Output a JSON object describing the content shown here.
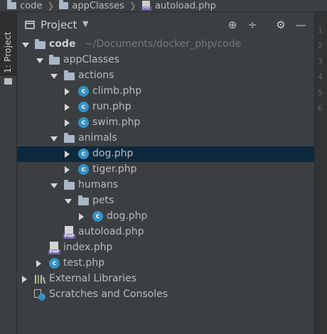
{
  "breadcrumb": {
    "items": [
      {
        "label": "code",
        "icon": "folder-icon"
      },
      {
        "label": "appClasses",
        "icon": "folder-icon"
      },
      {
        "label": "autoload.php",
        "icon": "php-file-icon"
      }
    ]
  },
  "side_tab": {
    "label": "1: Project"
  },
  "panel": {
    "title": "Project",
    "buttons": [
      "locate-icon",
      "collapse-all-icon",
      "gear-icon",
      "hide-icon"
    ]
  },
  "tree": {
    "root": {
      "name": "code",
      "path": "~/Documents/docker_php/code"
    },
    "items": [
      {
        "id": "appClasses",
        "label": "appClasses"
      },
      {
        "id": "actions",
        "label": "actions"
      },
      {
        "id": "climb",
        "label": "climb.php"
      },
      {
        "id": "run",
        "label": "run.php"
      },
      {
        "id": "swim",
        "label": "swim.php"
      },
      {
        "id": "animals",
        "label": "animals"
      },
      {
        "id": "dog",
        "label": "dog.php",
        "selected": true
      },
      {
        "id": "tiger",
        "label": "tiger.php"
      },
      {
        "id": "humans",
        "label": "humans"
      },
      {
        "id": "pets",
        "label": "pets"
      },
      {
        "id": "dog2",
        "label": "dog.php"
      },
      {
        "id": "autoload",
        "label": "autoload.php"
      },
      {
        "id": "index",
        "label": "index.php"
      },
      {
        "id": "test",
        "label": "test.php"
      },
      {
        "id": "extlib",
        "label": "External Libraries"
      },
      {
        "id": "scratches",
        "label": "Scratches and Consoles"
      }
    ]
  },
  "gutter": {
    "line_numbers": [
      "1",
      "2",
      "3",
      "4",
      "5",
      "6"
    ]
  },
  "colors": {
    "background": "#3c3f41",
    "selection": "#0d293e",
    "class_icon": "#3592c4",
    "php_badge": "#6e5fa0"
  }
}
